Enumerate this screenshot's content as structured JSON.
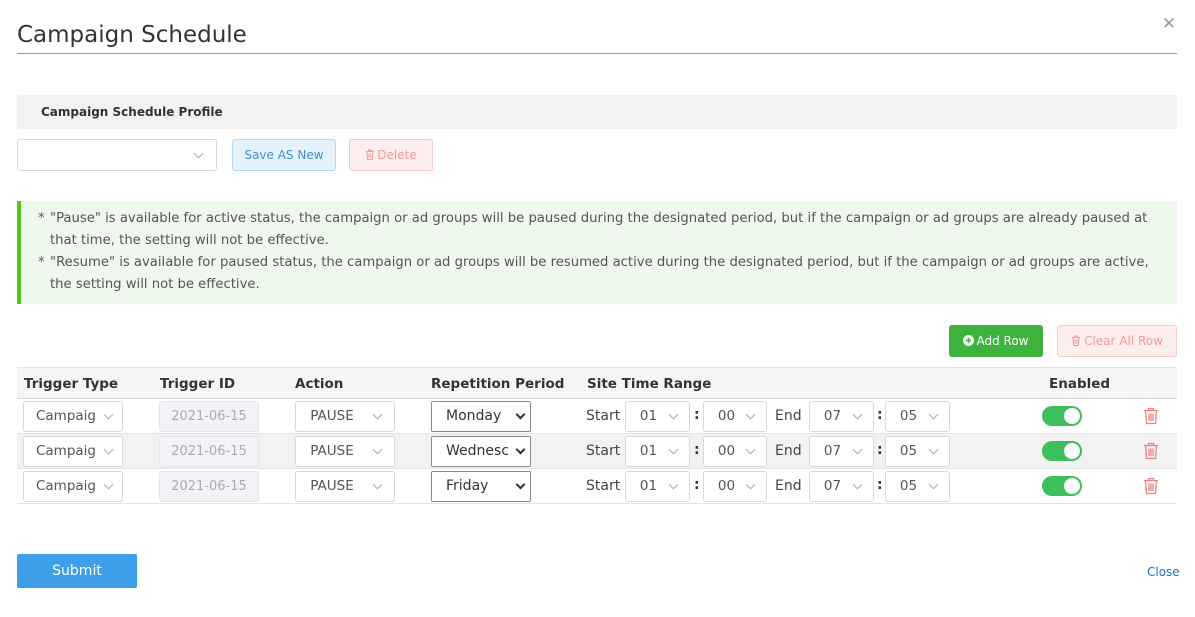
{
  "dialog": {
    "title": "Campaign Schedule",
    "close_icon": "close-icon"
  },
  "profile": {
    "heading": "Campaign Schedule Profile",
    "select_value": "",
    "save_label": "Save AS New",
    "delete_label": "Delete"
  },
  "notice": {
    "lines": [
      "\"Pause\" is available for active status, the campaign or ad groups will be paused during the designated period, but if the campaign or ad groups are already paused at that time, the setting will not be effective.",
      "\"Resume\" is available for paused status, the campaign or ad groups will be resumed active during the designated period, but if the campaign or ad groups are active, the setting will not be effective."
    ]
  },
  "toolbar": {
    "add_row_label": "Add Row",
    "clear_all_label": "Clear All Row"
  },
  "table": {
    "headers": {
      "trigger_type": "Trigger Type",
      "trigger_id": "Trigger ID",
      "action": "Action",
      "repetition": "Repetition Period",
      "time_range": "Site Time Range",
      "enabled": "Enabled"
    },
    "start_label": "Start",
    "end_label": "End",
    "colon": ":",
    "rows": [
      {
        "trigger_type": "Campaig",
        "trigger_id": "2021-06-15",
        "action": "PAUSE",
        "repetition": "Monday",
        "start_hour": "01",
        "start_min": "00",
        "end_hour": "07",
        "end_min": "05",
        "enabled": true
      },
      {
        "trigger_type": "Campaig",
        "trigger_id": "2021-06-15",
        "action": "PAUSE",
        "repetition": "Wednesc",
        "start_hour": "01",
        "start_min": "00",
        "end_hour": "07",
        "end_min": "05",
        "enabled": true
      },
      {
        "trigger_type": "Campaig",
        "trigger_id": "2021-06-15",
        "action": "PAUSE",
        "repetition": "Friday",
        "start_hour": "01",
        "start_min": "00",
        "end_hour": "07",
        "end_min": "05",
        "enabled": true
      }
    ]
  },
  "footer": {
    "submit_label": "Submit",
    "close_label": "Close"
  },
  "colors": {
    "primary": "#3e9ee8",
    "success": "#3db33d",
    "danger": "#f19a9a",
    "toggle_on": "#3cbf5c"
  }
}
